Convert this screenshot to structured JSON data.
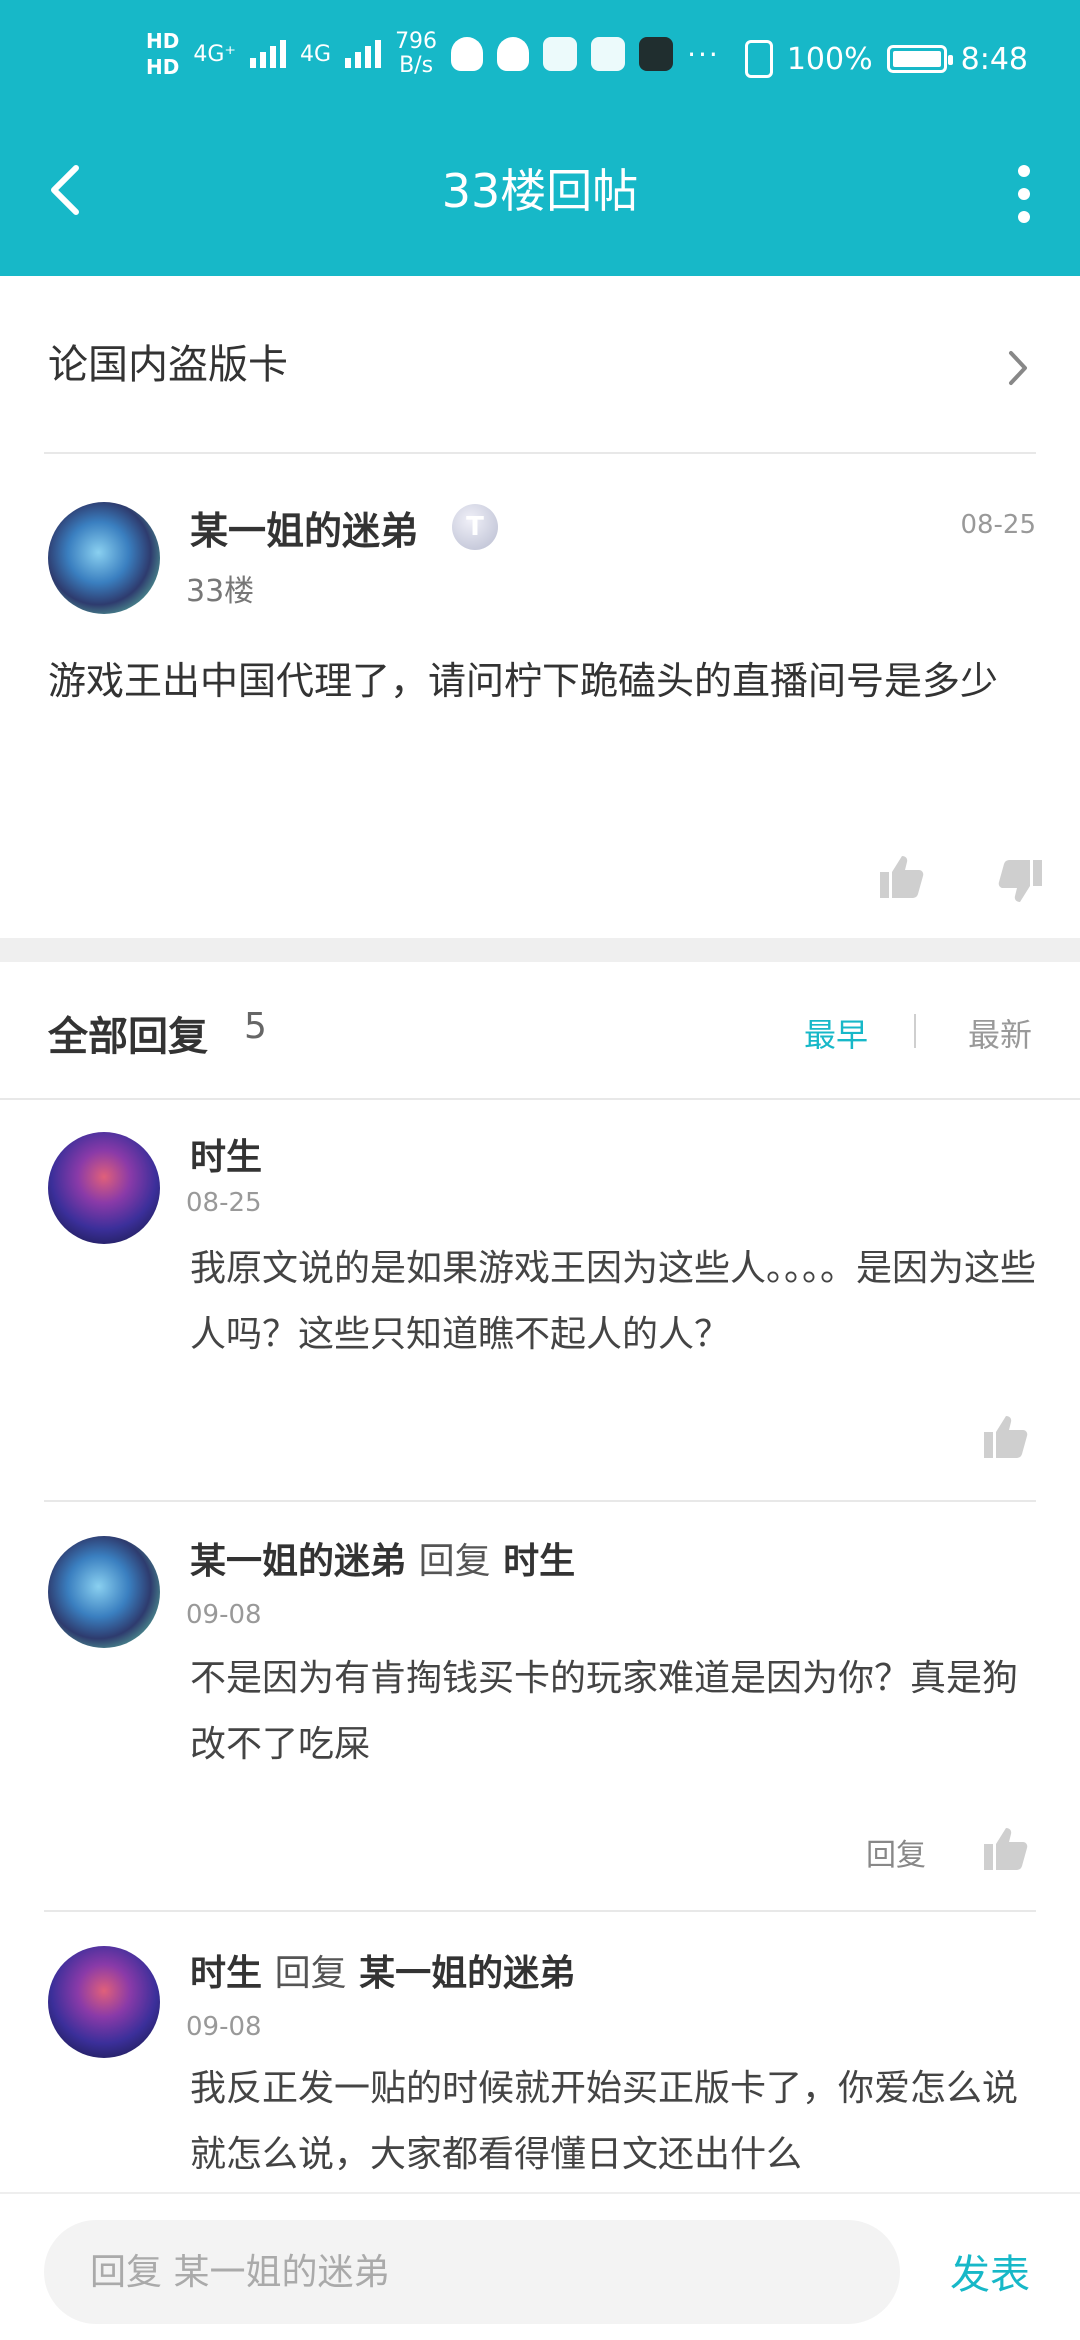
{
  "statusbar": {
    "hd1": "HD",
    "hd2": "HD",
    "net1": "4G⁺",
    "net2": "4G",
    "speed_value": "796",
    "speed_unit": "B/s",
    "more": "···",
    "battery_pct": "100%",
    "time": "8:48"
  },
  "header": {
    "title": "33楼回帖"
  },
  "topic": {
    "title": "论国内盗版卡"
  },
  "post": {
    "author": "某一姐的迷弟",
    "level_badge": "T",
    "floor": "33楼",
    "date": "08-25",
    "body": "游戏王出中国代理了，请问柠下跪磕头的直播间号是多少"
  },
  "replies_header": {
    "label": "全部回复",
    "count": "5",
    "sort_earliest": "最早",
    "sort_newest": "最新"
  },
  "replies": [
    {
      "author": "时生",
      "date": "08-25",
      "body": "我原文说的是如果游戏王因为这些人。。。。是因为这些人吗？这些只知道瞧不起人的人？"
    },
    {
      "author": "某一姐的迷弟",
      "reply_word": "回复",
      "target": "时生",
      "date": "09-08",
      "body": "不是因为有肯掏钱买卡的玩家难道是因为你？真是狗改不了吃屎",
      "reply_button": "回复"
    },
    {
      "author": "时生",
      "reply_word": "回复",
      "target": "某一姐的迷弟",
      "date": "09-08",
      "body": "我反正发一贴的时候就开始买正版卡了，你爱怎么说就怎么说，大家都看得懂日文还出什么"
    }
  ],
  "bottom": {
    "input_placeholder": "回复 某一姐的迷弟",
    "send_label": "发表"
  },
  "colors": {
    "accent": "#17b8c8",
    "divider": "#e8e8e8"
  }
}
